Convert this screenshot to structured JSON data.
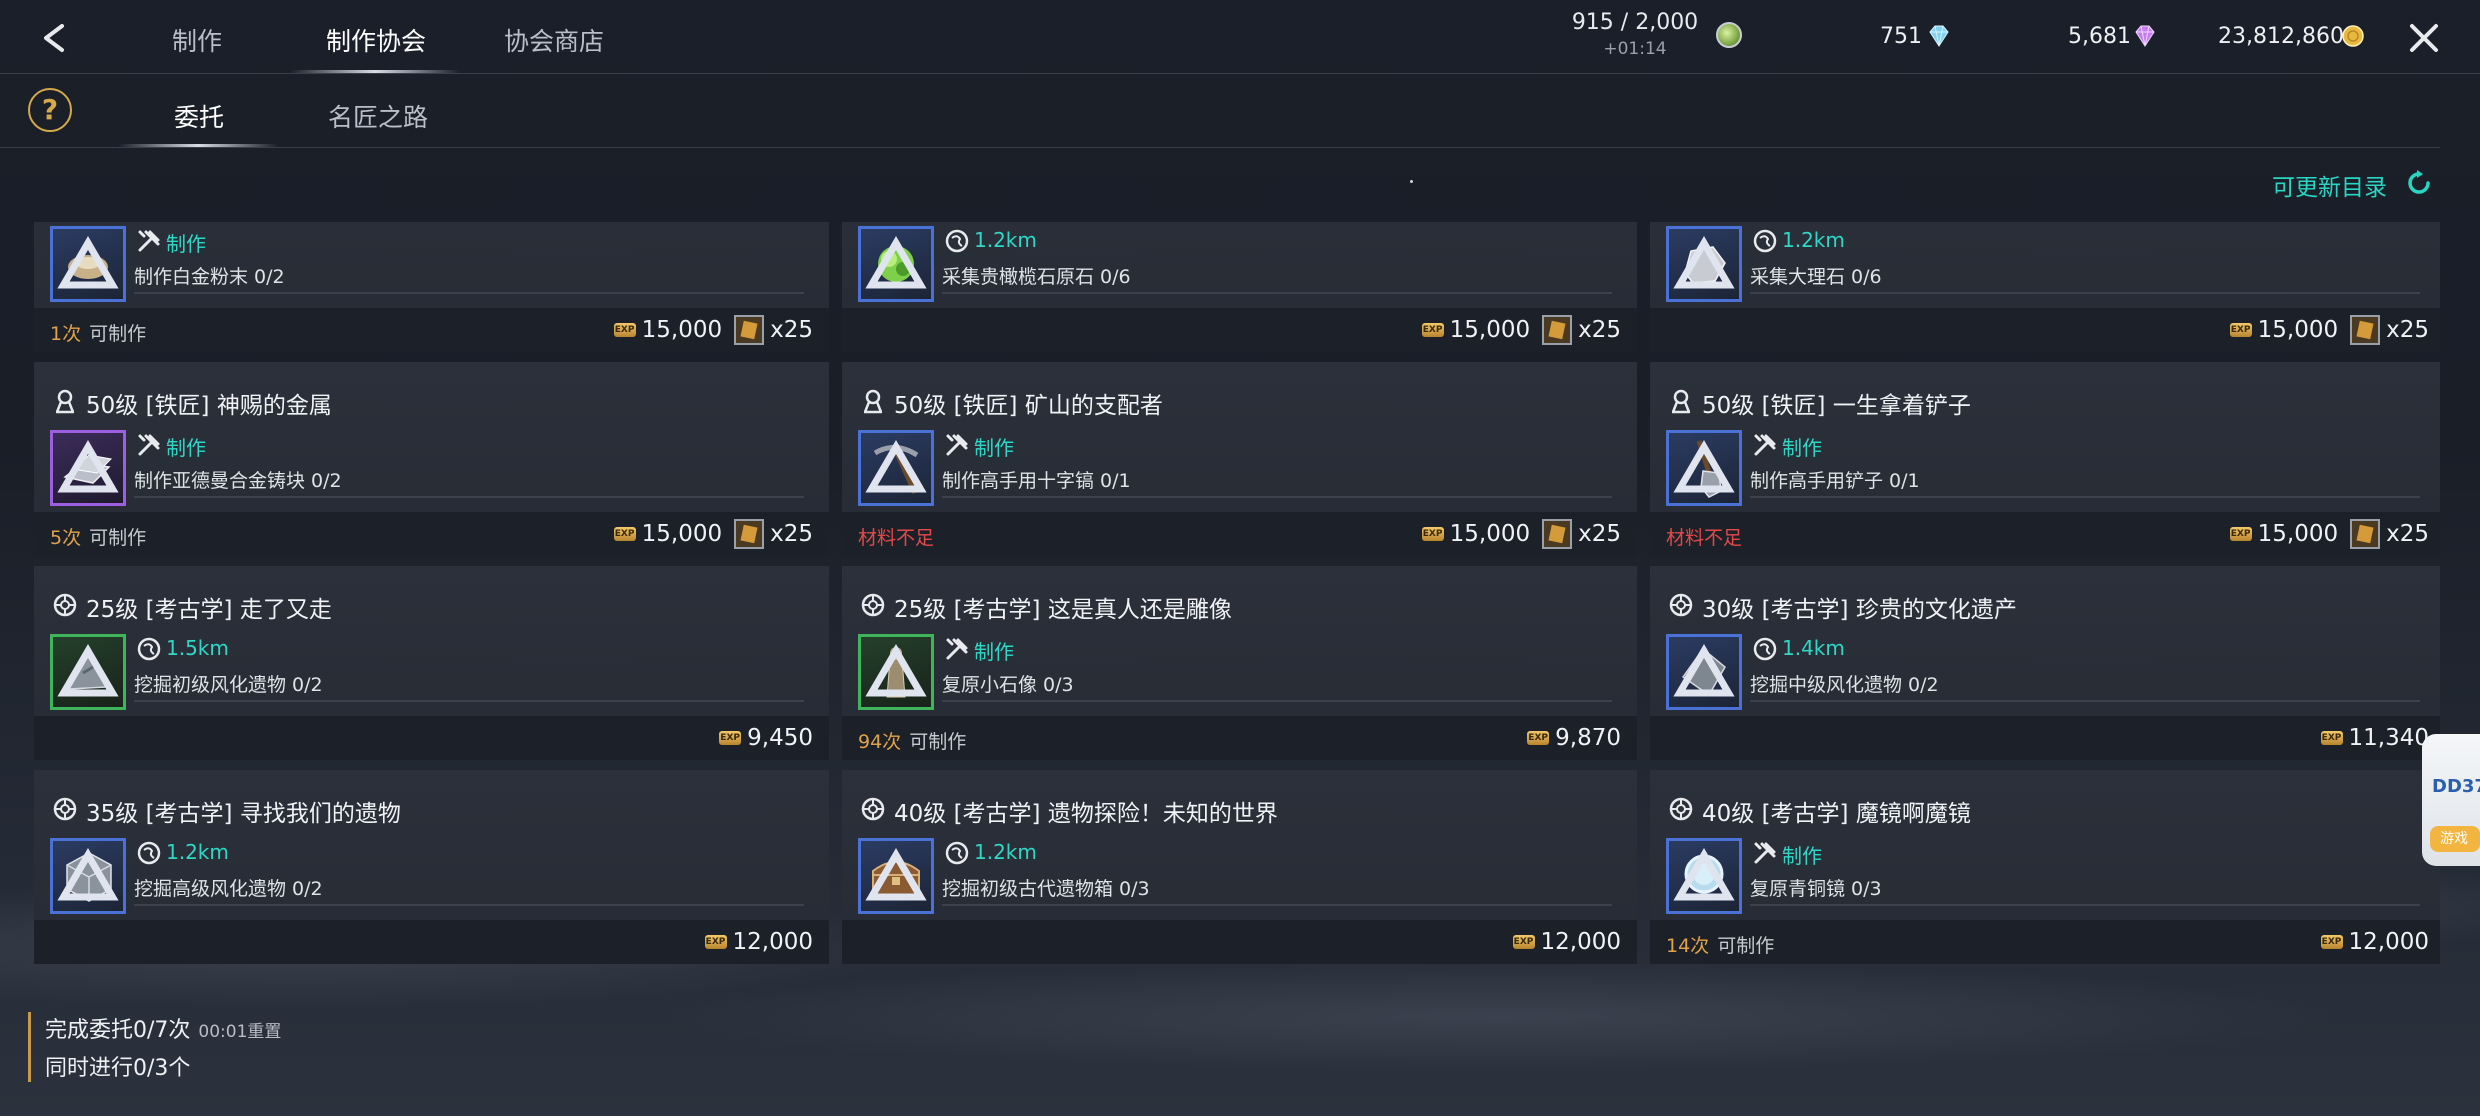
{
  "topbar": {
    "tabs": [
      {
        "label": "制作"
      },
      {
        "label": "制作协会"
      },
      {
        "label": "协会商店"
      }
    ],
    "stamina": {
      "value": "915 / 2,000",
      "timer": "+01:14"
    },
    "currencies": [
      {
        "value": "751",
        "icon": "diamond-blue-icon",
        "color": "#7fd3f0"
      },
      {
        "value": "5,681",
        "icon": "diamond-purple-icon",
        "color": "#c77df0"
      },
      {
        "value": "23,812,860",
        "icon": "gold-coin-icon",
        "color": "#e8b840"
      }
    ]
  },
  "subbar": {
    "help": "?",
    "tabs": [
      {
        "label": "委托"
      },
      {
        "label": "名匠之路"
      }
    ]
  },
  "refresh": {
    "label": "可更新目录"
  },
  "cards": [
    {
      "title": "",
      "type_label": "制作",
      "desc": "制作白金粉末 0/2",
      "footer": "1次",
      "footer_suffix": "可制作",
      "exp": "15,000",
      "reward": "x25"
    },
    {
      "title": "",
      "type_label": "1.2km",
      "desc": "采集贵橄榄石原石 0/6",
      "footer": "",
      "exp": "15,000",
      "reward": "x25"
    },
    {
      "title": "",
      "type_label": "1.2km",
      "desc": "采集大理石 0/6",
      "footer": "",
      "exp": "15,000",
      "reward": "x25"
    },
    {
      "title": "50级 [铁匠] 神赐的金属",
      "type_label": "制作",
      "desc": "制作亚德曼合金铸块 0/2",
      "footer": "5次",
      "footer_suffix": "可制作",
      "exp": "15,000",
      "reward": "x25"
    },
    {
      "title": "50级 [铁匠] 矿山的支配者",
      "type_label": "制作",
      "desc": "制作高手用十字镐 0/1",
      "shortage": "材料不足",
      "exp": "15,000",
      "reward": "x25"
    },
    {
      "title": "50级 [铁匠] 一生拿着铲子",
      "type_label": "制作",
      "desc": "制作高手用铲子 0/1",
      "shortage": "材料不足",
      "exp": "15,000",
      "reward": "x25"
    },
    {
      "title": "25级 [考古学] 走了又走",
      "type_label": "1.5km",
      "desc": "挖掘初级风化遗物 0/2",
      "footer": "",
      "exp": "9,450"
    },
    {
      "title": "25级 [考古学] 这是真人还是雕像",
      "type_label": "制作",
      "desc": "复原小石像 0/3",
      "footer": "94次",
      "footer_suffix": "可制作",
      "exp": "9,870"
    },
    {
      "title": "30级 [考古学] 珍贵的文化遗产",
      "type_label": "1.4km",
      "desc": "挖掘中级风化遗物 0/2",
      "footer": "",
      "exp": "11,340"
    },
    {
      "title": "35级 [考古学] 寻找我们的遗物",
      "type_label": "1.2km",
      "desc": "挖掘高级风化遗物 0/2",
      "footer": "",
      "exp": "12,000"
    },
    {
      "title": "40级 [考古学] 遗物探险！未知的世界",
      "type_label": "1.2km",
      "desc": "挖掘初级古代遗物箱 0/3",
      "footer": "",
      "exp": "12,000"
    },
    {
      "title": "40级 [考古学] 魔镜啊魔镜",
      "type_label": "制作",
      "desc": "复原青铜镜 0/3",
      "footer": "14次",
      "footer_suffix": "可制作",
      "exp": "12,000"
    }
  ],
  "exp_badge": "EXP",
  "footer": {
    "completed": "完成委托0/7次",
    "reset": "00:01重置",
    "concurrent": "同时进行0/3个"
  },
  "side_widget": {
    "text": "DD37",
    "sub": "游戏"
  }
}
